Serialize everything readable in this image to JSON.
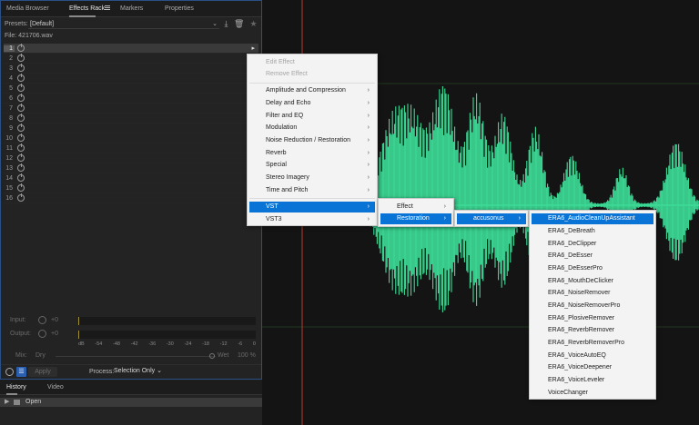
{
  "left_panel": {
    "tabs": [
      "Media Browser",
      "Effects Rack",
      "Markers",
      "Properties"
    ],
    "presets_label": "Presets:",
    "presets_value": "[Default]",
    "file_label": "File: 421706.wav",
    "slots": [
      "1",
      "2",
      "3",
      "4",
      "5",
      "6",
      "7",
      "8",
      "9",
      "10",
      "11",
      "12",
      "13",
      "14",
      "15",
      "16"
    ],
    "input_label": "Input:",
    "output_label": "Output:",
    "input_gain": "+0",
    "output_gain": "+0",
    "meter_scale": [
      "dB",
      "-54",
      "-48",
      "-42",
      "-36",
      "-30",
      "-24",
      "-18",
      "-12",
      "-6",
      "0"
    ],
    "mix_label": "Mix:",
    "dry_label": "Dry",
    "wet_label": "Wet",
    "mix_value": "100 %",
    "apply_label": "Apply",
    "process_label": "Process:",
    "process_value": "Selection Only"
  },
  "history_panel": {
    "tabs": [
      "History",
      "Video"
    ],
    "open_item": "Open"
  },
  "menus": {
    "main": {
      "edit_effect": "Edit Effect",
      "remove_effect": "Remove Effect",
      "items": [
        "Amplitude and Compression",
        "Delay and Echo",
        "Filter and EQ",
        "Modulation",
        "Noise Reduction / Restoration",
        "Reverb",
        "Special",
        "Stereo Imagery",
        "Time and Pitch"
      ],
      "vst": "VST",
      "vst3": "VST3"
    },
    "vst_sub": [
      "Effect",
      "Restoration"
    ],
    "restoration_sub": [
      "accusonus"
    ],
    "accusonus_sub": [
      "ERA6_AudioCleanUpAssistant",
      "ERA6_DeBreath",
      "ERA6_DeClipper",
      "ERA6_DeEsser",
      "ERA6_DeEsserPro",
      "ERA6_MouthDeClicker",
      "ERA6_NoiseRemover",
      "ERA6_NoiseRemoverPro",
      "ERA6_PlosiveRemover",
      "ERA6_ReverbRemover",
      "ERA6_ReverbRemoverPro",
      "ERA6_VoiceAutoEQ",
      "ERA6_VoiceDeepener",
      "ERA6_VoiceLeveler",
      "VoiceChanger"
    ]
  },
  "colors": {
    "waveform": "#3ddc97",
    "highlight": "#0a74d6",
    "grid": "#2a5a2a",
    "playhead": "#c0392b"
  }
}
